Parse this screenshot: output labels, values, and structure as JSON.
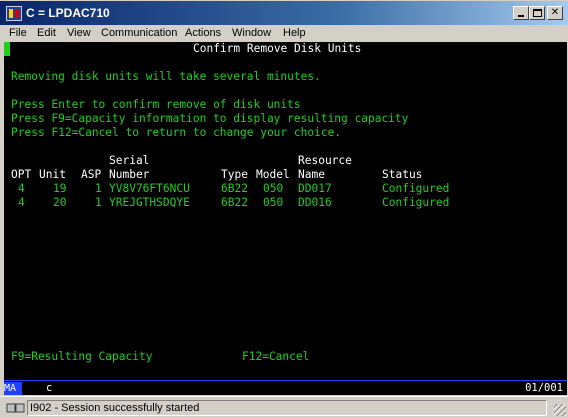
{
  "window": {
    "title": "C = LPDAC710"
  },
  "menu": [
    {
      "label": "File",
      "name": "menu-file"
    },
    {
      "label": "Edit",
      "name": "menu-edit"
    },
    {
      "label": "View",
      "name": "menu-view"
    },
    {
      "label": "Communication",
      "name": "menu-communication"
    },
    {
      "label": "Actions",
      "name": "menu-actions"
    },
    {
      "label": "Window",
      "name": "menu-window"
    },
    {
      "label": "Help",
      "name": "menu-help"
    }
  ],
  "screen": {
    "title": "Confirm Remove Disk Units",
    "message": "Removing disk units will take several minutes.",
    "instructions": [
      "Press Enter to confirm remove of disk units",
      "Press F9=Capacity information to display resulting capacity",
      "Press F12=Cancel to return to change your choice."
    ],
    "headers_line1": {
      "serial": "Serial",
      "resource": "Resource"
    },
    "headers_line2": {
      "opt": "OPT",
      "unit": "Unit",
      "asp": "ASP",
      "serial": "Number",
      "type": "Type",
      "model": "Model",
      "resource": "Name",
      "status": "Status"
    },
    "rows": [
      {
        "opt": "4",
        "unit": "19",
        "asp": "1",
        "serial": "YV8V76FT6NCU",
        "type": "6B22",
        "model": "050",
        "resource": "DD017",
        "status": "Configured"
      },
      {
        "opt": "4",
        "unit": "20",
        "asp": "1",
        "serial": "YREJGTHSDQYE",
        "type": "6B22",
        "model": "050",
        "resource": "DD016",
        "status": "Configured"
      }
    ],
    "function_keys": {
      "f9": "F9=Resulting Capacity",
      "f12": "F12=Cancel"
    }
  },
  "oia": {
    "mode": "MA",
    "indicator": "c",
    "position": "01/001"
  },
  "statusbar": {
    "message": "I902 - Session successfully started"
  },
  "colors": {
    "terminal_bg": "#000000",
    "terminal_text": "#1fd01f",
    "title_bar": "#0a246a"
  }
}
